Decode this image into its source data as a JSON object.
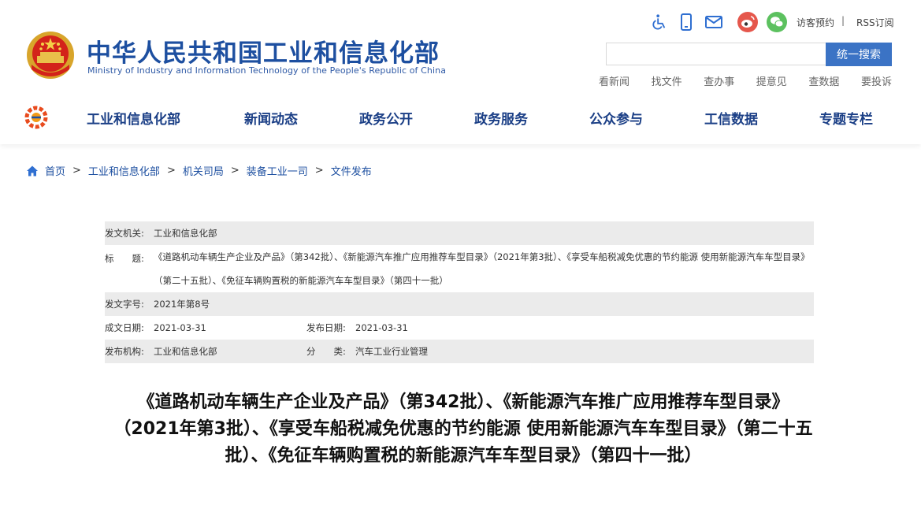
{
  "site": {
    "name_cn": "中华人民共和国工业和信息化部",
    "name_en": "Ministry of Industry and Information Technology of the People's Republic of China",
    "accent_color": "#1d4fa0"
  },
  "utility": {
    "icons": [
      "accessibility-icon",
      "mobile-icon",
      "mail-icon",
      "weibo-icon",
      "wechat-icon"
    ],
    "visitor_login": "访客预约",
    "separator": "|",
    "rss": "RSS订阅"
  },
  "search": {
    "placeholder": "",
    "value": "",
    "button_label": "统一搜索"
  },
  "quick_links": [
    "看新闻",
    "找文件",
    "查办事",
    "提意见",
    "查数据",
    "要投诉"
  ],
  "nav": [
    "工业和信息化部",
    "新闻动态",
    "政务公开",
    "政务服务",
    "公众参与",
    "工信数据",
    "专题专栏"
  ],
  "breadcrumb": [
    "首页",
    "工业和信息化部",
    "机关司局",
    "装备工业一司",
    "文件发布"
  ],
  "breadcrumb_sep": ">",
  "meta": {
    "issuer_label": "发文机关:",
    "issuer": "工业和信息化部",
    "title_label": "标　　题:",
    "title": "《道路机动车辆生产企业及产品》（第342批）、《新能源汽车推广应用推荐车型目录》（2021年第3批）、《享受车船税减免优惠的节约能源 使用新能源汽车车型目录》（第二十五批）、《免征车辆购置税的新能源汽车车型目录》（第四十一批）",
    "doc_no_label": "发文字号:",
    "doc_no": "2021年第8号",
    "created_label": "成文日期:",
    "created": "2021-03-31",
    "published_label": "发布日期:",
    "published": "2021-03-31",
    "agency_label": "发布机构:",
    "agency": "工业和信息化部",
    "category_label": "分　　类:",
    "category": "汽车工业行业管理"
  },
  "headline": "《道路机动车辆生产企业及产品》（第342批）、《新能源汽车推广应用推荐车型目录》（2021年第3批）、《享受车船税减免优惠的节约能源 使用新能源汽车车型目录》（第二十五批）、《免征车辆购置税的新能源汽车车型目录》（第四十一批）"
}
